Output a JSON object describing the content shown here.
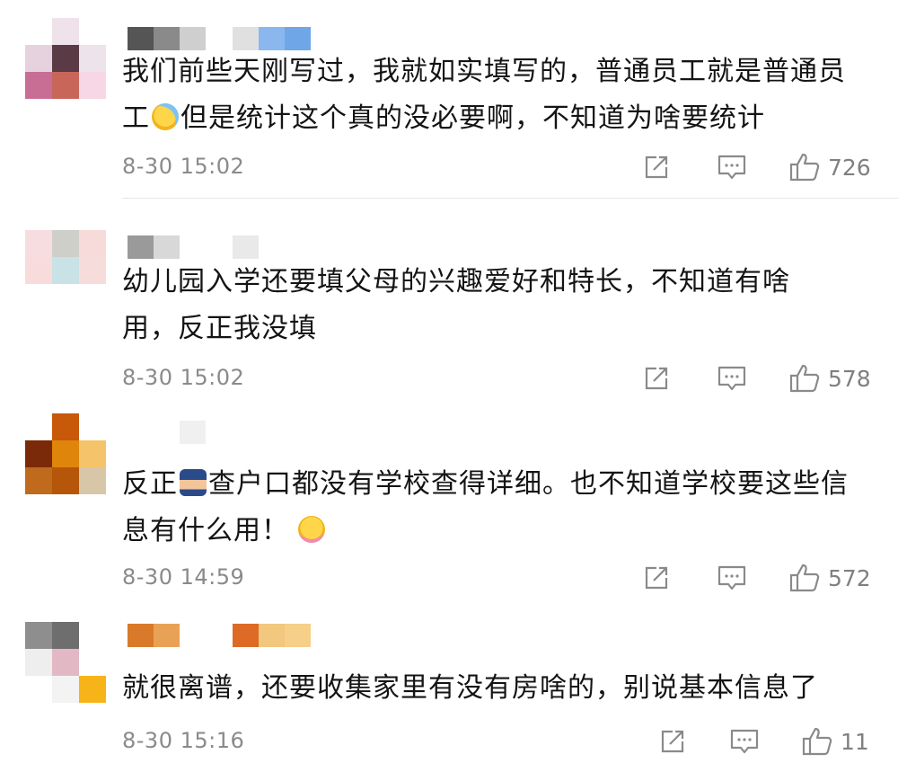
{
  "comments": [
    {
      "text_before": "我们前些天刚写过，我就如实填写的，普通员工就是普通员工",
      "text_after": "但是统计这个真的没必要啊，不知道为啥要统计",
      "emoji": "laughing-crying-emoji",
      "time": "8-30 15:02",
      "likes": "726",
      "avatar_colors": [
        "#ffffff",
        "#efe2ea",
        "#ffffff",
        "#e6d2df",
        "#5a3a44",
        "#ece4ea",
        "#c86e94",
        "#c8665a",
        "#f7d7e5"
      ],
      "name_colors": [
        "#555555",
        "#8a8a8a",
        "#cfcfcf",
        "gap",
        "#e0e0e0",
        "#8ab8ee",
        "#6ea6e8"
      ]
    },
    {
      "text_before": "幼儿园入学还要填父母的兴趣爱好和特长，不知道有啥用，反正我没填",
      "text_after": "",
      "time": "8-30 15:02",
      "likes": "578",
      "avatar_colors": [
        "#f8dde0",
        "#cfcfc9",
        "#f7dada",
        "#f8dcdc",
        "#c9e2e6",
        "#f7dcdc",
        "#ffffff",
        "#ffffff",
        "#ffffff"
      ],
      "name_colors": [
        "#9a9a9a",
        "#d8d8d8",
        "#ffffff",
        "gap",
        "#e9e9e9"
      ]
    },
    {
      "text_before": "反正",
      "emoji": "police-officer-emoji",
      "text_after": "查户口都没有学校查得详细。也不知道学校要这些信息有什么用！",
      "emoji2": "hugging-face-emoji",
      "time": "8-30 14:59",
      "likes": "572",
      "avatar_colors": [
        "#ffffff",
        "#c8580a",
        "#ffffff",
        "#7a2a08",
        "#e0850c",
        "#f4c36a",
        "#c06a1e",
        "#b5560a",
        "#d7c6a8"
      ],
      "name_colors": [
        "#ffffff",
        "#ffffff",
        "#f0f0f0"
      ]
    },
    {
      "text_before": "就很离谱，还要收集家里有没有房啥的，别说基本信息了",
      "text_after": "",
      "time": "8-30 15:16",
      "likes": "11",
      "avatar_colors": [
        "#8e8e8e",
        "#6e6e6e",
        "#ffffff",
        "#eeeeee",
        "#e2b8c4",
        "#ffffff",
        "#ffffff",
        "#f3f3f3",
        "#f7b418"
      ],
      "name_colors": [
        "#d97a2a",
        "#e9a255",
        "#ffffff",
        "gap",
        "#dd6a25",
        "#f2c77e",
        "#f6cf88"
      ]
    }
  ],
  "icons": {
    "share": "share-icon",
    "reply": "comment-icon",
    "like": "thumbs-up-icon"
  }
}
